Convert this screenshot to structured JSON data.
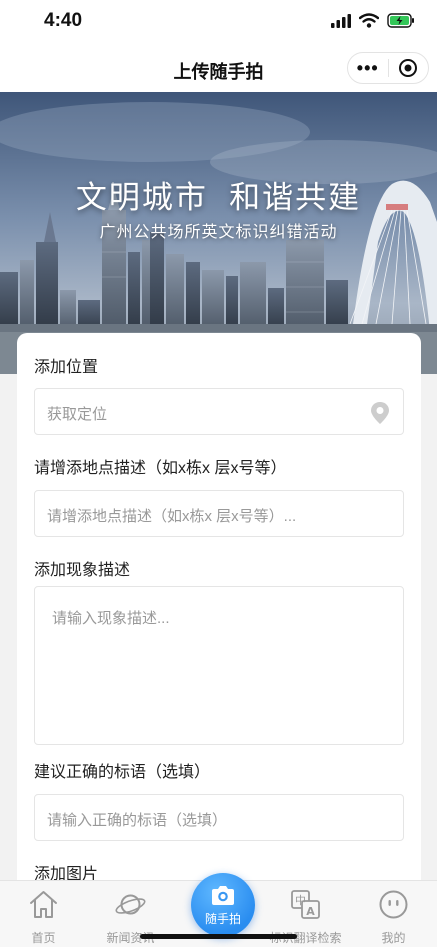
{
  "status": {
    "time": "4:40"
  },
  "nav": {
    "title": "上传随手拍",
    "more_icon": "more-dots-icon",
    "close_icon": "target-close-icon"
  },
  "banner": {
    "title": "文明城市  和谐共建",
    "subtitle": "广州公共场所英文标识纠错活动"
  },
  "form": {
    "location_label": "添加位置",
    "location_placeholder": "获取定位",
    "address_label": "请增添地点描述（如x栋x 层x号等）",
    "address_placeholder": "请增添地点描述（如x栋x 层x号等）...",
    "phenomenon_label": "添加现象描述",
    "phenomenon_placeholder": "请输入现象描述...",
    "slogan_label": "建议正确的标语（选填）",
    "slogan_placeholder": "请输入正确的标语（选填）",
    "image_label": "添加图片"
  },
  "tabbar": {
    "items": [
      {
        "label": "首页",
        "icon": "home-icon"
      },
      {
        "label": "新闻资讯",
        "icon": "planet-icon"
      },
      {
        "label": "随手拍",
        "icon": "camera-icon"
      },
      {
        "label": "标识翻译检索",
        "icon": "translate-icon"
      },
      {
        "label": "我的",
        "icon": "face-icon"
      }
    ]
  },
  "colors": {
    "accent": "#2a8df0",
    "tab_inactive": "#999999",
    "card_bg": "#ffffff"
  }
}
